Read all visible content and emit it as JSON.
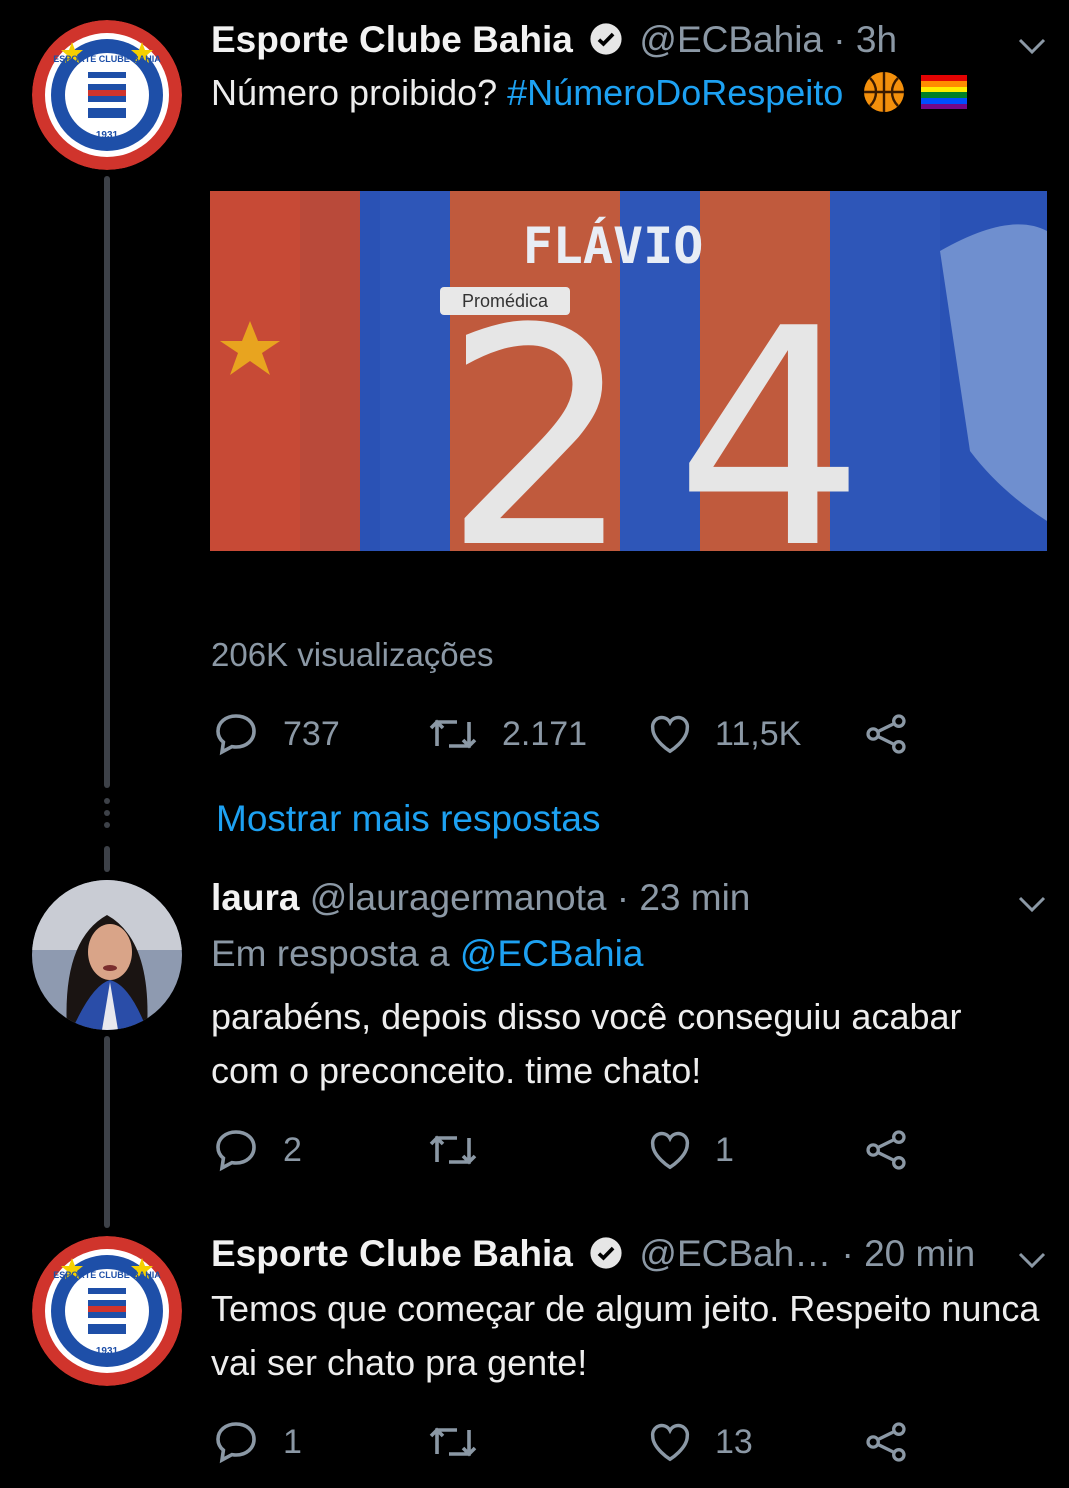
{
  "colors": {
    "accent": "#1da1f2",
    "muted": "#8b98a5",
    "background": "#000000"
  },
  "tweets": [
    {
      "display_name": "Esporte Clube Bahia",
      "handle": "@ECBahia",
      "time": "· 3h",
      "verified": true,
      "text_plain": "Número proibido? ",
      "hashtag": "#NúmeroDoRespeito",
      "emoji_names": [
        "basketball-emoji",
        "rainbow-flag-emoji"
      ],
      "media": {
        "jersey_name": "FLÁVIO",
        "jersey_number_left": "2",
        "jersey_number_right": "4",
        "sponsor": "Promédica"
      },
      "views": "206K visualizações",
      "reply_count": "737",
      "retweet_count": "2.171",
      "like_count": "11,5K"
    },
    {
      "display_name": "laura",
      "handle": "@lauragermanota",
      "time": "· 23 min",
      "reply_to_label": "Em resposta a ",
      "reply_to_handle": "@ECBahia",
      "text": "parabéns, depois disso você conseguiu acabar com o preconceito. time chato!",
      "reply_count": "2",
      "retweet_count": "",
      "like_count": "1"
    },
    {
      "display_name": "Esporte Clube Bahia",
      "handle": "@ECBah…",
      "time": "· 20 min",
      "verified": true,
      "text": "Temos que começar de algum jeito. Respeito nunca vai ser chato pra gente!",
      "reply_count": "1",
      "retweet_count": "",
      "like_count": "13"
    }
  ],
  "show_more_replies": "Mostrar mais respostas",
  "logo": {
    "top_text": "ESPORTE CLUBE BAHIA",
    "year": "1931"
  }
}
